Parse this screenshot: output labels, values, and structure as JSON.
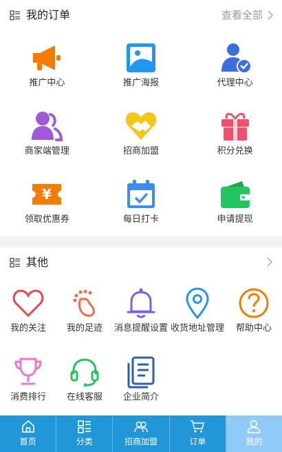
{
  "orders": {
    "title": "我的订单",
    "more_label": "查看全部",
    "items": [
      {
        "label": "推广中心",
        "icon": "megaphone-icon"
      },
      {
        "label": "推广海报",
        "icon": "poster-icon"
      },
      {
        "label": "代理中心",
        "icon": "agent-icon"
      },
      {
        "label": "商家端管理",
        "icon": "merchant-icon"
      },
      {
        "label": "招商加盟",
        "icon": "handshake-icon"
      },
      {
        "label": "积分兑换",
        "icon": "gift-icon"
      },
      {
        "label": "领取优惠券",
        "icon": "coupon-icon"
      },
      {
        "label": "每日打卡",
        "icon": "calendar-check-icon"
      },
      {
        "label": "申请提现",
        "icon": "wallet-icon"
      }
    ]
  },
  "other": {
    "title": "其他",
    "items": [
      {
        "label": "我的关注",
        "icon": "heart-icon"
      },
      {
        "label": "我的足迹",
        "icon": "footprint-icon"
      },
      {
        "label": "消息提醒设置",
        "icon": "bell-icon"
      },
      {
        "label": "收货地址管理",
        "icon": "location-pin-icon"
      },
      {
        "label": "帮助中心",
        "icon": "help-icon"
      },
      {
        "label": "消费排行",
        "icon": "trophy-icon"
      },
      {
        "label": "在线客服",
        "icon": "headset-icon"
      },
      {
        "label": "企业简介",
        "icon": "document-icon"
      }
    ]
  },
  "tabbar": {
    "items": [
      {
        "label": "首页",
        "icon": "home-icon"
      },
      {
        "label": "分类",
        "icon": "category-icon"
      },
      {
        "label": "招商加盟",
        "icon": "users-icon"
      },
      {
        "label": "订单",
        "icon": "cart-icon"
      },
      {
        "label": "我的",
        "icon": "user-icon"
      }
    ],
    "active_index": 4
  },
  "colors": {
    "tabbar_bg": "#2196d9",
    "tabbar_active": "#90caf9",
    "orange": "#f57c00",
    "blue": "#2196f3",
    "purple": "#a259d9",
    "gold": "#f5c518",
    "red": "#f0506e",
    "green": "#22c55e"
  }
}
